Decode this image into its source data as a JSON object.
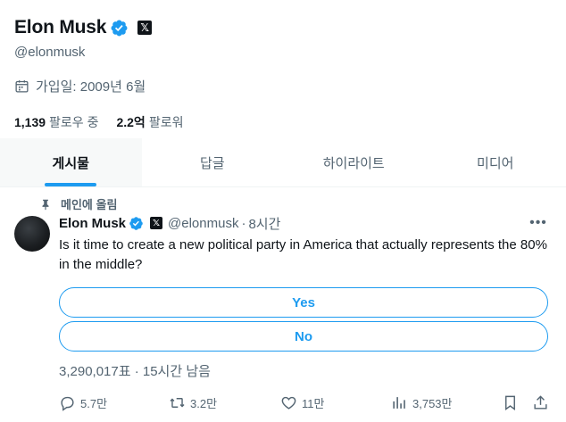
{
  "profile": {
    "name": "Elon Musk",
    "handle": "@elonmusk",
    "joined": "가입일: 2009년 6월",
    "following_count": "1,139",
    "following_label": "팔로우 중",
    "followers_count": "2.2억",
    "followers_label": "팔로워",
    "x_badge": "𝕏"
  },
  "tabs": [
    {
      "label": "게시물",
      "active": true
    },
    {
      "label": "답글",
      "active": false
    },
    {
      "label": "하이라이트",
      "active": false
    },
    {
      "label": "미디어",
      "active": false
    }
  ],
  "post": {
    "pinned_label": "메인에 올림",
    "author_name": "Elon Musk",
    "author_handle": "@elonmusk",
    "dot": "·",
    "time": "8시간",
    "more": "•••",
    "text": "Is it time to create a new political party in America that actually represents the 80% in the middle?",
    "poll": {
      "options": [
        "Yes",
        "No"
      ],
      "meta": "3,290,017표 · 15시간 남음"
    },
    "actions": {
      "replies": "5.7만",
      "reposts": "3.2만",
      "likes": "11만",
      "views": "3,753만"
    }
  },
  "colors": {
    "accent": "#1d9bf0",
    "text": "#0f1419",
    "muted": "#536471"
  }
}
